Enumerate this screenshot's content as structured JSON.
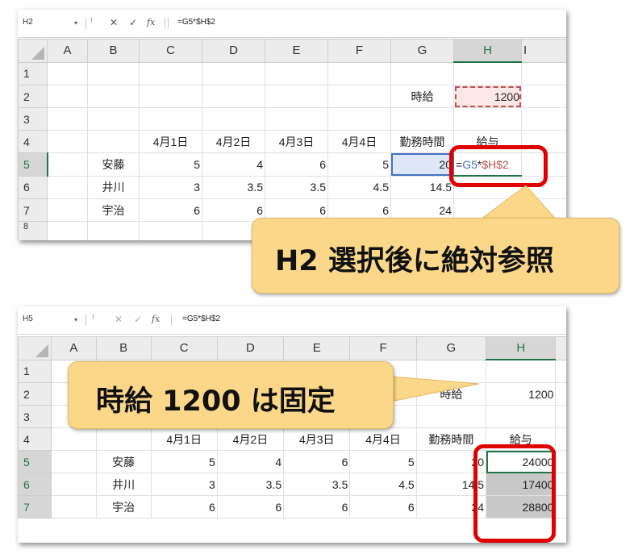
{
  "top": {
    "name_box": "H2",
    "formula": "=G5*$H$2",
    "columns": [
      "A",
      "B",
      "C",
      "D",
      "E",
      "F",
      "G",
      "H",
      "I"
    ],
    "row_numbers": [
      "1",
      "2",
      "3",
      "4",
      "5",
      "6",
      "7",
      "8"
    ],
    "g2": "時給",
    "h2": "1200",
    "dates": [
      "4月1日",
      "4月2日",
      "4月3日",
      "4月4日"
    ],
    "g4": "勤務時間",
    "h4": "給与",
    "rows": [
      {
        "name": "安藤",
        "d1": "5",
        "d2": "4",
        "d3": "6",
        "d4": "5",
        "total": "20"
      },
      {
        "name": "井川",
        "d1": "3",
        "d2": "3.5",
        "d3": "3.5",
        "d4": "4.5",
        "total": "14.5"
      },
      {
        "name": "宇治",
        "d1": "6",
        "d2": "6",
        "d3": "6",
        "d4": "6",
        "total": "24"
      }
    ],
    "edit_formula": {
      "eq": "=",
      "ref1": "G5",
      "op": "*",
      "ref2": "$H$2"
    }
  },
  "callout1": "H2 選択後に絶対参照",
  "bottom": {
    "name_box": "H5",
    "formula": "=G5*$H$2",
    "columns": [
      "A",
      "B",
      "C",
      "D",
      "E",
      "F",
      "G",
      "H"
    ],
    "row_numbers": [
      "1",
      "2",
      "3",
      "4",
      "5",
      "6",
      "7"
    ],
    "g2": "時給",
    "h2": "1200",
    "dates": [
      "4月1日",
      "4月2日",
      "4月3日",
      "4月4日"
    ],
    "g4": "勤務時間",
    "h4": "給与",
    "rows": [
      {
        "name": "安藤",
        "d1": "5",
        "d2": "4",
        "d3": "6",
        "d4": "5",
        "total": "20",
        "pay": "24000"
      },
      {
        "name": "井川",
        "d1": "3",
        "d2": "3.5",
        "d3": "3.5",
        "d4": "4.5",
        "total": "14.5",
        "pay": "17400"
      },
      {
        "name": "宇治",
        "d1": "6",
        "d2": "6",
        "d3": "6",
        "d4": "6",
        "total": "24",
        "pay": "28800"
      }
    ]
  },
  "callout2": "時給 1200 は固定",
  "colors": {
    "callout_fill": "#fbd889",
    "highlight_red": "#e00000",
    "excel_green": "#217346",
    "ref_blue": "#4472c4",
    "ref_red": "#c0504d"
  }
}
